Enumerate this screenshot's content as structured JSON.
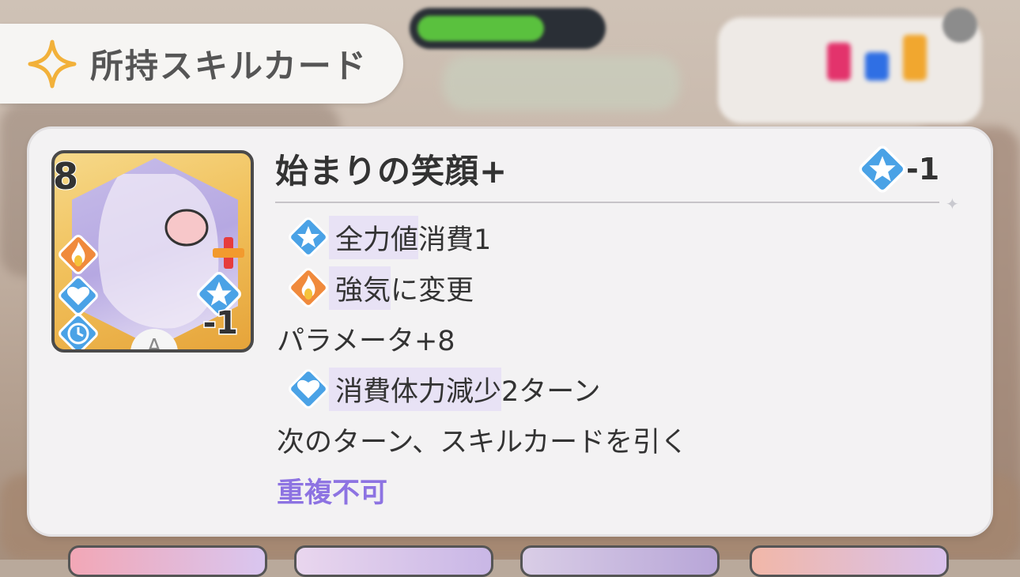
{
  "header": {
    "title": "所持スキルカード",
    "icon": "sparkle-icon"
  },
  "card": {
    "name": "始まりの笑顔+",
    "cost": "8",
    "stamina_cost": "-1",
    "grade": "A",
    "effects": [
      {
        "icon": "star-icon",
        "highlight": "全力値",
        "rest": "消費1"
      },
      {
        "icon": "fire-icon",
        "highlight": "強気",
        "rest": "に変更"
      },
      {
        "icon": "",
        "highlight": "",
        "rest": "パラメータ+8"
      },
      {
        "icon": "heart-icon",
        "highlight": "消費体力減少",
        "rest": "2ターン"
      },
      {
        "icon": "",
        "highlight": "",
        "rest": "次のターン、スキルカードを引く"
      }
    ],
    "restriction": "重複不可"
  },
  "colors": {
    "accent_gold": "#f2b13a",
    "star_blue": "#4aa2e6",
    "fire_orange": "#f08a3c",
    "restriction_purple": "#8d73e2",
    "hp_green": "#5ac13e"
  }
}
